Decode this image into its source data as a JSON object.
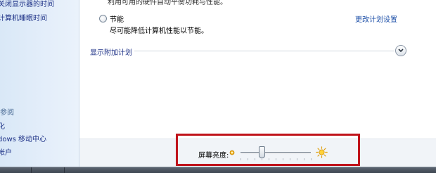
{
  "sidebar": {
    "links": [
      {
        "label": "关闭显示器的时间"
      },
      {
        "label": "计算机睡眠时间"
      }
    ],
    "see_also": {
      "heading": "参阅",
      "links": [
        {
          "label": "化"
        },
        {
          "label": "dows 移动中心"
        },
        {
          "label": "帐户"
        }
      ]
    }
  },
  "main": {
    "faded_text": "利用可用的硬件自动平衡功耗与性能。",
    "plan": {
      "name": "节能",
      "description": "尽可能降低计算机性能以节能。",
      "selected": false
    },
    "change_plan_link": "更改计划设置",
    "additional_plans_label": "显示附加计划",
    "expand_icon": "chevron-down-icon"
  },
  "brightness": {
    "label": "屏幕亮度:",
    "level": 0.3,
    "ticks": 10,
    "min_icon": "dim-sun-icon",
    "max_icon": "bright-sun-icon"
  },
  "colors": {
    "link": "#1e50a8",
    "highlight_box": "#c0131b",
    "sidebar_bg": "#d9e8f7"
  }
}
